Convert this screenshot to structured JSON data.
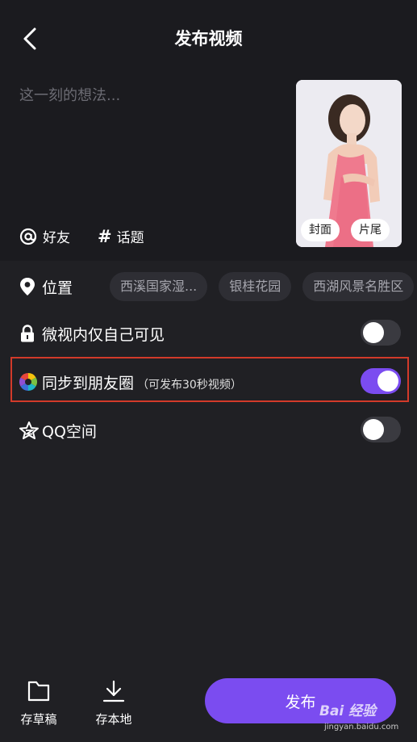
{
  "header": {
    "title": "发布视频",
    "back_icon": "chevron-left-icon"
  },
  "compose": {
    "placeholder": "这一刻的想法...",
    "mentions": [
      {
        "glyph": "@",
        "label": "好友"
      },
      {
        "glyph": "#",
        "label": "话题"
      }
    ],
    "thumbnail": {
      "cover_label": "封面",
      "end_label": "片尾"
    }
  },
  "location": {
    "label": "位置",
    "icon": "location-pin-icon",
    "chips": [
      "西溪国家湿...",
      "银桂花园",
      "西湖风景名胜区"
    ]
  },
  "settings": [
    {
      "icon": "lock-icon",
      "label": "微视内仅自己可见",
      "sub": "",
      "on": false
    },
    {
      "icon": "moments-aperture-icon",
      "label": "同步到朋友圈",
      "sub": "（可发布30秒视频）",
      "on": true
    },
    {
      "icon": "qzone-star-icon",
      "label": "QQ空间",
      "sub": "",
      "on": false
    }
  ],
  "bottom_bar": {
    "draft_label": "存草稿",
    "local_label": "存本地",
    "publish_label": "发布"
  },
  "watermark": {
    "brand": "Bai 经验",
    "site": "jingyan.baidu.com"
  },
  "colors": {
    "accent": "#7b4cf0",
    "background": "#202024",
    "panel": "#1b1b1f",
    "highlight_border": "#d23a2a"
  }
}
